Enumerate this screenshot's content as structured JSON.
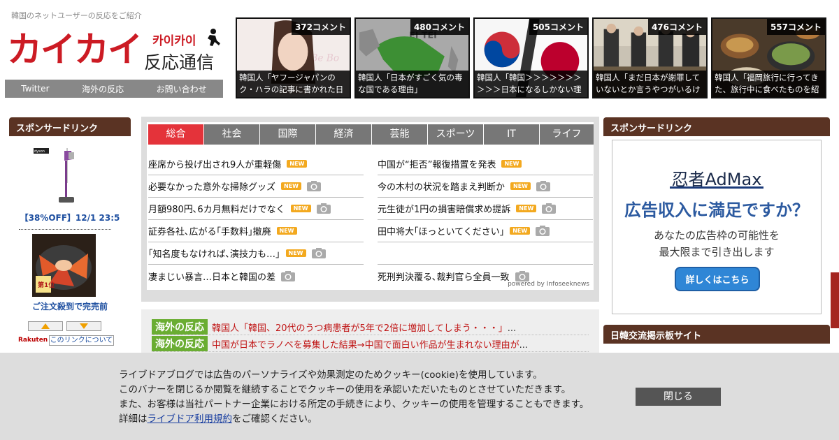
{
  "header": {
    "tagline": "韓国のネットユーザーの反応をご紹介",
    "logo_main": "カイカイ",
    "logo_kana": "카이카이",
    "logo_sub": "反応通信",
    "nav": [
      "Twitter",
      "海外の反応",
      "お問い合わせ"
    ]
  },
  "featured": [
    {
      "count": "372コメント",
      "caption": "韓国人「ヤフージャパンのク・ハラの記事に書かれた日"
    },
    {
      "count": "480コメント",
      "caption": "韓国人「日本がすごく気の毒な国である理由」"
    },
    {
      "count": "505コメント",
      "caption": "韓国人「韓国＞＞＞＞＞＞＞＞＞＞日本になるしかない理"
    },
    {
      "count": "476コメント",
      "caption": "韓国人「まだ日本が謝罪していないとか言うやつがいるけ"
    },
    {
      "count": "557コメント",
      "caption": "韓国人「福岡旅行に行ってきた、旅行中に食べたものを紹"
    }
  ],
  "left_sidebar": {
    "heading": "スポンサードリンク",
    "product1_link": "【38%OFF】12/1 23:5",
    "product2_link": "ご注文殺到で完売前",
    "rakuten": "Rakuten",
    "about_link": "このリンクについて"
  },
  "news": {
    "tabs": [
      "総合",
      "社会",
      "国際",
      "経済",
      "芸能",
      "スポーツ",
      "IT",
      "ライフ"
    ],
    "active_tab": "総合",
    "badge_label": "NEW",
    "left": [
      {
        "title": "座席から投げ出され9人が重軽傷",
        "new": true,
        "camera": false
      },
      {
        "title": "必要なかった意外な掃除グッズ",
        "new": true,
        "camera": true
      },
      {
        "title": "月額980円､6カ月無料だけでなく",
        "new": true,
        "camera": true
      },
      {
        "title": "証券各社､広がる｢手数料｣撤廃",
        "new": true,
        "camera": false
      },
      {
        "title": "｢知名度もなければ､演技力も…｣",
        "new": true,
        "camera": true
      },
      {
        "title": "凄まじい暴言…日本と韓国の差",
        "new": false,
        "camera": true
      }
    ],
    "right": [
      {
        "title": "中国が“拒否”報復措置を発表",
        "new": true,
        "camera": false
      },
      {
        "title": "今の木村の状況を踏まえ判断か",
        "new": true,
        "camera": true
      },
      {
        "title": "元生徒が1円の損害賠償求め提訴",
        "new": true,
        "camera": true
      },
      {
        "title": "田中将大｢ほっといてください｣",
        "new": true,
        "camera": true
      },
      {
        "title": "",
        "new": false,
        "camera": false
      },
      {
        "title": "死刑判決覆る､裁判官ら全員一致",
        "new": false,
        "camera": true
      }
    ],
    "powered": "powered by Infoseeknews"
  },
  "overseas": [
    {
      "badge": "海外の反応",
      "text": "韓国人「韓国、20代のうつ病患者が5年で2倍に増加してしまう・・・」",
      "ellipsis": "..."
    },
    {
      "badge": "海外の反応",
      "text": "中国が日本でラノベを募集した結果→中国で面白い作品が生まれない理由が",
      "ellipsis": "..."
    }
  ],
  "right_sidebar": {
    "heading": "スポンサードリンク",
    "ad_logo": "忍者AdMax",
    "ad_headline": "広告収入に満足ですか？",
    "ad_body_line1": "あなたの広告枠の可能性を",
    "ad_body_line2": "最大限まで引き出します",
    "ad_button": "詳しくはこちら",
    "heading2": "日韓交流掲示板サイト"
  },
  "cookie": {
    "line1": "ライブドアブログでは広告のパーソナライズや効果測定のためクッキー(cookie)を使用しています。",
    "line2": "このバナーを閉じるか閲覧を継続することでクッキーの使用を承認いただいたものとさせていただきます。",
    "line3": "また、お客様は当社パートナー企業における所定の手続きにより、クッキーの使用を管理することもできます。",
    "line4_prefix": "詳細は",
    "line4_link": "ライブドア利用規約",
    "line4_suffix": "をご確認ください。",
    "close_label": "閉じる"
  },
  "colors": {
    "brand_red": "#cc1b24",
    "sidebar_brown": "#5a3323",
    "tab_active": "#e4333a",
    "new_badge": "#f3a91f",
    "overseas_green": "#6aad32"
  }
}
